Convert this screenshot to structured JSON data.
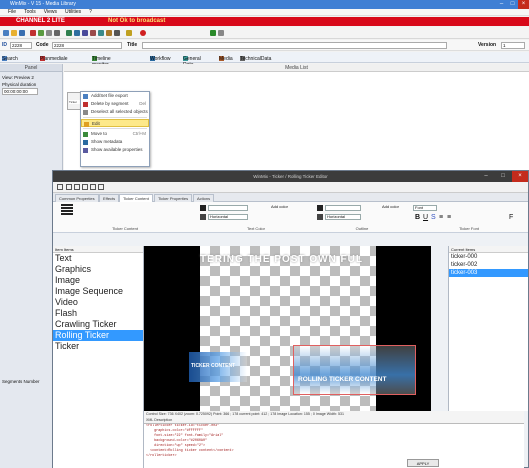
{
  "back_window": {
    "title": "WinMix - V 15 - Media Library",
    "menu": [
      "File",
      "Tools",
      "Views",
      "Utilities",
      "?"
    ],
    "channel_name": "CHANNEL 2 LITE",
    "broadcast_status": "Not Ok to broadcast",
    "id_label": "ID",
    "id_value": "2228",
    "code_label": "Code",
    "code_value": "2228",
    "title_label": "Title",
    "version_label": "Version",
    "version_value": "1",
    "tabs": [
      {
        "label": "Search",
        "icon": "search-icon"
      },
      {
        "label": "Planmediale",
        "icon": "calendar-icon"
      },
      {
        "label": "Timeline monitor",
        "icon": "monitor-icon"
      },
      {
        "label": "Workflow",
        "icon": "workflow-icon"
      },
      {
        "label": "General Data",
        "icon": "data-icon"
      },
      {
        "label": "Media",
        "icon": "media-icon"
      },
      {
        "label": "TechnicalData",
        "icon": "tech-icon"
      }
    ],
    "side_header": "Panel",
    "side_items": [
      "View: Preview 2",
      "Physical duration",
      "00:00:00:00"
    ],
    "side_footer": "Segments Number",
    "main_header": "Media List",
    "thumb_label": "Ticker",
    "context_menu": [
      {
        "label": "Add/Set file export",
        "shortcut": ""
      },
      {
        "label": "Delete by segment",
        "shortcut": "Del"
      },
      {
        "label": "Deselect all selected objects",
        "shortcut": ""
      },
      {
        "label": "Edit",
        "shortcut": "",
        "selected": true
      },
      {
        "label": "Move to",
        "shortcut": "Ctrl+M"
      },
      {
        "label": "Show metadata",
        "shortcut": ""
      },
      {
        "label": "Show available properties",
        "shortcut": ""
      }
    ]
  },
  "dialog": {
    "title": "WinMix - Ticker / Rolling Ticker Editor",
    "tabs": [
      "Common Properties",
      "Effects",
      "Ticker Content",
      "Ticker Properties",
      "Actions"
    ],
    "active_tab": "Ticker Content",
    "prop_labels": {
      "content": "Ticker Content",
      "text_color": "Text Color",
      "outline": "Outline",
      "font": "Ticker Font"
    },
    "add_color": "Add color",
    "horizontal": "Horizontal",
    "font_name": "Font",
    "left_header": "Item Items",
    "item_types": [
      "Text",
      "Graphics",
      "Image",
      "Image Sequence",
      "Video",
      "Flash",
      "Crawling Ticker",
      "Rolling Ticker",
      "Ticker"
    ],
    "selected_type": "Rolling Ticker",
    "preview_scroll_text": "TERING  THE  POST  OWN  FUL",
    "ticker_label": "TICKER CONTENT",
    "rolling_label": "ROLLING TICKER CONTENT",
    "status_line": "Control Size: 736 X402 (zoom: 0.725092) Point: 366 ; 178 current point: 412 ; 178 Image Location: 155 ; 0 Image Width: 531",
    "xml_header": "XML Description",
    "xml_lines": [
      "<rollerticker ticker-id=\"ticker-003\"",
      "    graphics-color=\"#FFFFFF\"",
      "    font-size=\"22\" font-family=\"Arial\"",
      "    background-color=\"#2060A0\"",
      "    direction=\"up\" speed=\"2\">",
      "  <content>Rolling ticker content</content>",
      "</rollerticker>"
    ],
    "apply_label": "APPLY",
    "right_header": "Current Items",
    "current_items": [
      "ticker-000",
      "ticker-002",
      "ticker-003"
    ],
    "selected_item": "ticker-003"
  }
}
